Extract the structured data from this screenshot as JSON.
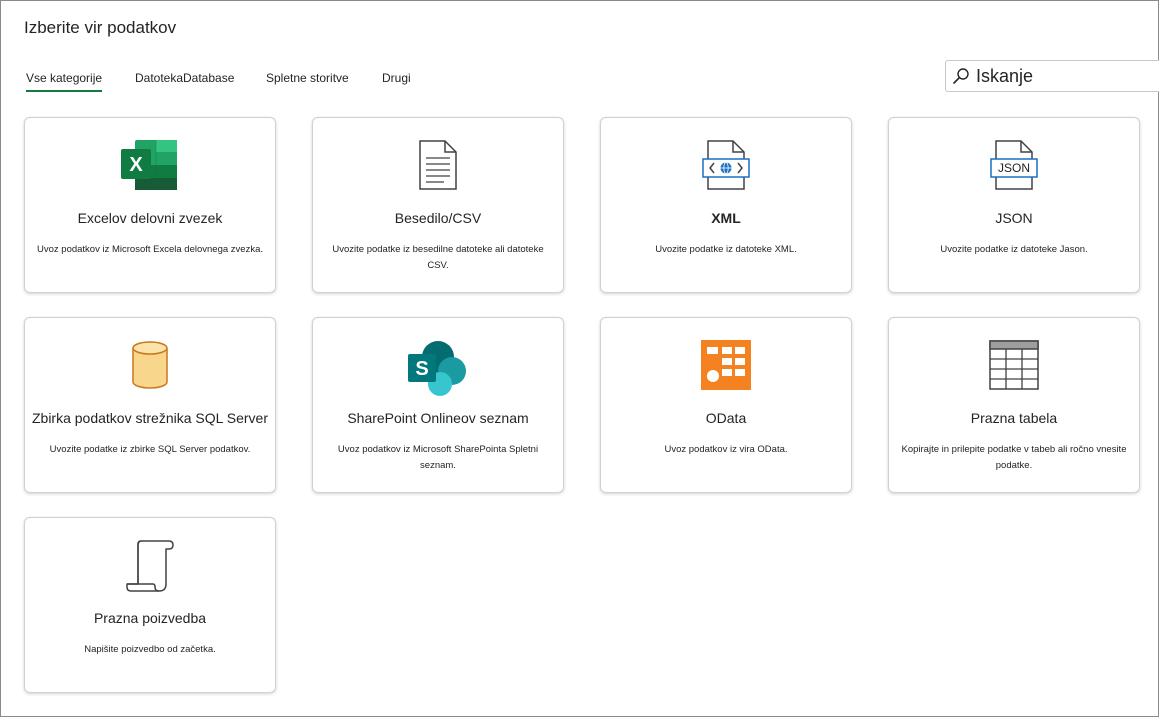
{
  "dialog": {
    "title": "Izberite vir podatkov"
  },
  "tabs": [
    {
      "label": "Vse kategorije",
      "active": true
    },
    {
      "label": "Datoteka"
    },
    {
      "label": "Database"
    },
    {
      "label": "Spletne storitve"
    },
    {
      "label": "Drugi"
    }
  ],
  "search": {
    "placeholder": "Iskanje",
    "icon": "search-icon"
  },
  "cards": [
    {
      "title": "Excelov delovni zvezek",
      "description": "Uvoz podatkov iz Microsoft Excela delovnega zvezka.",
      "icon": "excel-icon"
    },
    {
      "title": "Besedilo/CSV",
      "description": "Uvozite podatke iz besedilne datoteke ali datoteke CSV.",
      "icon": "text-file-icon"
    },
    {
      "title": "XML",
      "description": "Uvozite podatke iz datoteke XML.",
      "icon": "xml-file-icon"
    },
    {
      "title": "JSON",
      "description": "Uvozite podatke iz datoteke Jason.",
      "icon": "json-file-icon"
    },
    {
      "title": "Zbirka podatkov strežnika SQL Server",
      "description": "Uvozite podatke iz zbirke SQL Server podatkov.",
      "icon": "database-icon"
    },
    {
      "title": "SharePoint Onlineov seznam",
      "description": "Uvoz podatkov iz Microsoft SharePointa Spletni seznam.",
      "icon": "sharepoint-icon"
    },
    {
      "title": "OData",
      "description": "Uvoz podatkov iz vira OData.",
      "icon": "odata-icon"
    },
    {
      "title": "Prazna tabela",
      "description": "Kopirajte in prilepite podatke v tabeb ali ročno vnesite podatke.",
      "icon": "table-icon"
    },
    {
      "title": "Prazna poizvedba",
      "description": "Napišite poizvedbo od začetka.",
      "icon": "scroll-icon"
    }
  ],
  "colors": {
    "accent": "#107c41",
    "excel": "#107c41",
    "sharepoint": "#03787c",
    "odata": "#f58220",
    "database": "#f8d68c",
    "xml_blue": "#1c6fc2"
  }
}
